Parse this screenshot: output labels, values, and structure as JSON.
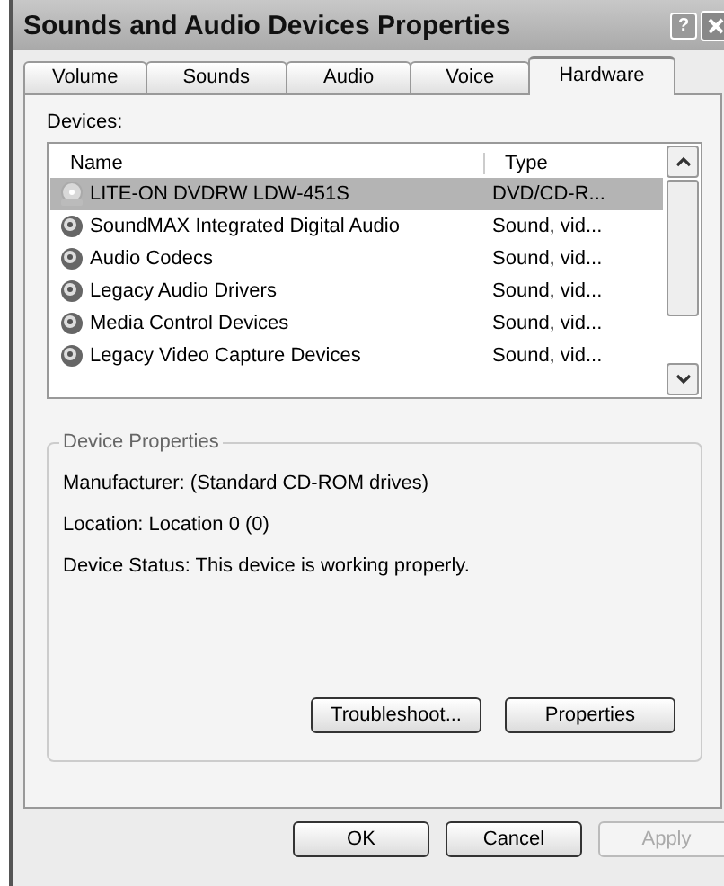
{
  "window": {
    "title": "Sounds and Audio Devices Properties",
    "help": "?"
  },
  "tabs": [
    {
      "label": "Volume",
      "selected": false
    },
    {
      "label": "Sounds",
      "selected": false
    },
    {
      "label": "Audio",
      "selected": false
    },
    {
      "label": "Voice",
      "selected": false
    },
    {
      "label": "Hardware",
      "selected": true
    }
  ],
  "devices": {
    "label": "Devices:",
    "columns": [
      "Name",
      "Type"
    ],
    "rows": [
      {
        "name": "LITE-ON DVDRW LDW-451S",
        "type": "DVD/CD-R...",
        "kind": "drive",
        "selected": true
      },
      {
        "name": "SoundMAX Integrated Digital Audio",
        "type": "Sound, vid...",
        "kind": "sound",
        "selected": false
      },
      {
        "name": "Audio Codecs",
        "type": "Sound, vid...",
        "kind": "sound",
        "selected": false
      },
      {
        "name": "Legacy Audio Drivers",
        "type": "Sound, vid...",
        "kind": "sound",
        "selected": false
      },
      {
        "name": "Media Control Devices",
        "type": "Sound, vid...",
        "kind": "sound",
        "selected": false
      },
      {
        "name": "Legacy Video Capture Devices",
        "type": "Sound, vid...",
        "kind": "sound",
        "selected": false
      }
    ]
  },
  "device_properties": {
    "title": "Device Properties",
    "lines": [
      "Manufacturer: (Standard CD-ROM drives)",
      "Location: Location 0 (0)",
      "Device Status: This device is working properly."
    ],
    "buttons": [
      {
        "label": "Troubleshoot...",
        "disabled": false
      },
      {
        "label": "Properties",
        "disabled": false
      }
    ]
  },
  "buttons": [
    {
      "label": "OK",
      "disabled": false
    },
    {
      "label": "Cancel",
      "disabled": false
    },
    {
      "label": "Apply",
      "disabled": true
    }
  ]
}
